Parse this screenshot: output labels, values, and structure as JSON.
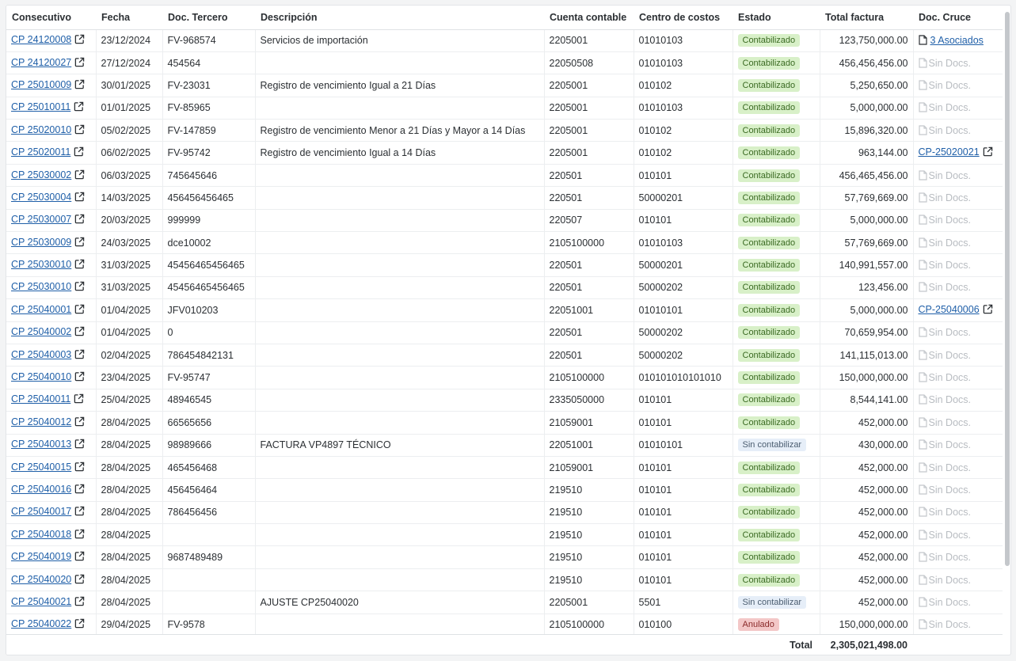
{
  "columns": [
    "Consecutivo",
    "Fecha",
    "Doc. Tercero",
    "Descripción",
    "Cuenta contable",
    "Centro de costos",
    "Estado",
    "Total factura",
    "Doc. Cruce"
  ],
  "rows": [
    {
      "id": "CP 24120008",
      "fecha": "23/12/2024",
      "doc": "FV-968574",
      "desc": "Servicios de importación",
      "cuenta": "2205001",
      "centro": "01010103",
      "estado": "Contabilizado",
      "estado_type": "ok",
      "total": "123,750,000.00",
      "cruce": "3 Asociados",
      "cruce_type": "assoc"
    },
    {
      "id": "CP 24120027",
      "fecha": "27/12/2024",
      "doc": "454564",
      "desc": "",
      "cuenta": "22050508",
      "centro": "01010103",
      "estado": "Contabilizado",
      "estado_type": "ok",
      "total": "456,456,456.00",
      "cruce": "Sin Docs.",
      "cruce_type": "none"
    },
    {
      "id": "CP 25010009",
      "fecha": "30/01/2025",
      "doc": "FV-23031",
      "desc": "Registro de vencimiento Igual a 21 Días",
      "cuenta": "2205001",
      "centro": "010102",
      "estado": "Contabilizado",
      "estado_type": "ok",
      "total": "5,250,650.00",
      "cruce": "Sin Docs.",
      "cruce_type": "none"
    },
    {
      "id": "CP 25010011",
      "fecha": "01/01/2025",
      "doc": "FV-85965",
      "desc": "",
      "cuenta": "2205001",
      "centro": "01010103",
      "estado": "Contabilizado",
      "estado_type": "ok",
      "total": "5,000,000.00",
      "cruce": "Sin Docs.",
      "cruce_type": "none"
    },
    {
      "id": "CP 25020010",
      "fecha": "05/02/2025",
      "doc": "FV-147859",
      "desc": "Registro de vencimiento Menor a 21 Días y Mayor a 14 Días",
      "cuenta": "2205001",
      "centro": "010102",
      "estado": "Contabilizado",
      "estado_type": "ok",
      "total": "15,896,320.00",
      "cruce": "Sin Docs.",
      "cruce_type": "none"
    },
    {
      "id": "CP 25020011",
      "fecha": "06/02/2025",
      "doc": "FV-95742",
      "desc": "Registro de vencimiento Igual a 14 Días",
      "cuenta": "2205001",
      "centro": "010102",
      "estado": "Contabilizado",
      "estado_type": "ok",
      "total": "963,144.00",
      "cruce": "CP-25020021",
      "cruce_type": "link"
    },
    {
      "id": "CP 25030002",
      "fecha": "06/03/2025",
      "doc": "745645646",
      "desc": "",
      "cuenta": "220501",
      "centro": "010101",
      "estado": "Contabilizado",
      "estado_type": "ok",
      "total": "456,465,456.00",
      "cruce": "Sin Docs.",
      "cruce_type": "none"
    },
    {
      "id": "CP 25030004",
      "fecha": "14/03/2025",
      "doc": "456456456465",
      "desc": "",
      "cuenta": "220501",
      "centro": "50000201",
      "estado": "Contabilizado",
      "estado_type": "ok",
      "total": "57,769,669.00",
      "cruce": "Sin Docs.",
      "cruce_type": "none"
    },
    {
      "id": "CP 25030007",
      "fecha": "20/03/2025",
      "doc": "999999",
      "desc": "",
      "cuenta": "220507",
      "centro": "010101",
      "estado": "Contabilizado",
      "estado_type": "ok",
      "total": "5,000,000.00",
      "cruce": "Sin Docs.",
      "cruce_type": "none"
    },
    {
      "id": "CP 25030009",
      "fecha": "24/03/2025",
      "doc": "dce10002",
      "desc": "",
      "cuenta": "2105100000",
      "centro": "01010103",
      "estado": "Contabilizado",
      "estado_type": "ok",
      "total": "57,769,669.00",
      "cruce": "Sin Docs.",
      "cruce_type": "none"
    },
    {
      "id": "CP 25030010",
      "fecha": "31/03/2025",
      "doc": "45456465456465",
      "desc": "",
      "cuenta": "220501",
      "centro": "50000201",
      "estado": "Contabilizado",
      "estado_type": "ok",
      "total": "140,991,557.00",
      "cruce": "Sin Docs.",
      "cruce_type": "none"
    },
    {
      "id": "CP 25030010",
      "fecha": "31/03/2025",
      "doc": "45456465456465",
      "desc": "",
      "cuenta": "220501",
      "centro": "50000202",
      "estado": "Contabilizado",
      "estado_type": "ok",
      "total": "123,456.00",
      "cruce": "Sin Docs.",
      "cruce_type": "none"
    },
    {
      "id": "CP 25040001",
      "fecha": "01/04/2025",
      "doc": "JFV010203",
      "desc": "",
      "cuenta": "22051001",
      "centro": "01010101",
      "estado": "Contabilizado",
      "estado_type": "ok",
      "total": "5,000,000.00",
      "cruce": "CP-25040006",
      "cruce_type": "link"
    },
    {
      "id": "CP 25040002",
      "fecha": "01/04/2025",
      "doc": "0",
      "desc": "",
      "cuenta": "220501",
      "centro": "50000202",
      "estado": "Contabilizado",
      "estado_type": "ok",
      "total": "70,659,954.00",
      "cruce": "Sin Docs.",
      "cruce_type": "none"
    },
    {
      "id": "CP 25040003",
      "fecha": "02/04/2025",
      "doc": "786454842131",
      "desc": "",
      "cuenta": "220501",
      "centro": "50000202",
      "estado": "Contabilizado",
      "estado_type": "ok",
      "total": "141,115,013.00",
      "cruce": "Sin Docs.",
      "cruce_type": "none"
    },
    {
      "id": "CP 25040010",
      "fecha": "23/04/2025",
      "doc": "FV-95747",
      "desc": "",
      "cuenta": "2105100000",
      "centro": "010101010101010",
      "estado": "Contabilizado",
      "estado_type": "ok",
      "total": "150,000,000.00",
      "cruce": "Sin Docs.",
      "cruce_type": "none"
    },
    {
      "id": "CP 25040011",
      "fecha": "25/04/2025",
      "doc": "48946545",
      "desc": "",
      "cuenta": "2335050000",
      "centro": "010101",
      "estado": "Contabilizado",
      "estado_type": "ok",
      "total": "8,544,141.00",
      "cruce": "Sin Docs.",
      "cruce_type": "none"
    },
    {
      "id": "CP 25040012",
      "fecha": "28/04/2025",
      "doc": "66565656",
      "desc": "",
      "cuenta": "21059001",
      "centro": "010101",
      "estado": "Contabilizado",
      "estado_type": "ok",
      "total": "452,000.00",
      "cruce": "Sin Docs.",
      "cruce_type": "none"
    },
    {
      "id": "CP 25040013",
      "fecha": "28/04/2025",
      "doc": "98989666",
      "desc": "FACTURA VP4897 TÉCNICO",
      "cuenta": "22051001",
      "centro": "01010101",
      "estado": "Sin contabilizar",
      "estado_type": "pend",
      "total": "430,000.00",
      "cruce": "Sin Docs.",
      "cruce_type": "none"
    },
    {
      "id": "CP 25040015",
      "fecha": "28/04/2025",
      "doc": "465456468",
      "desc": "",
      "cuenta": "21059001",
      "centro": "010101",
      "estado": "Contabilizado",
      "estado_type": "ok",
      "total": "452,000.00",
      "cruce": "Sin Docs.",
      "cruce_type": "none"
    },
    {
      "id": "CP 25040016",
      "fecha": "28/04/2025",
      "doc": "456456464",
      "desc": "",
      "cuenta": "219510",
      "centro": "010101",
      "estado": "Contabilizado",
      "estado_type": "ok",
      "total": "452,000.00",
      "cruce": "Sin Docs.",
      "cruce_type": "none"
    },
    {
      "id": "CP 25040017",
      "fecha": "28/04/2025",
      "doc": "786456456",
      "desc": "",
      "cuenta": "219510",
      "centro": "010101",
      "estado": "Contabilizado",
      "estado_type": "ok",
      "total": "452,000.00",
      "cruce": "Sin Docs.",
      "cruce_type": "none"
    },
    {
      "id": "CP 25040018",
      "fecha": "28/04/2025",
      "doc": "",
      "desc": "",
      "cuenta": "219510",
      "centro": "010101",
      "estado": "Contabilizado",
      "estado_type": "ok",
      "total": "452,000.00",
      "cruce": "Sin Docs.",
      "cruce_type": "none"
    },
    {
      "id": "CP 25040019",
      "fecha": "28/04/2025",
      "doc": "9687489489",
      "desc": "",
      "cuenta": "219510",
      "centro": "010101",
      "estado": "Contabilizado",
      "estado_type": "ok",
      "total": "452,000.00",
      "cruce": "Sin Docs.",
      "cruce_type": "none"
    },
    {
      "id": "CP 25040020",
      "fecha": "28/04/2025",
      "doc": "",
      "desc": "",
      "cuenta": "219510",
      "centro": "010101",
      "estado": "Contabilizado",
      "estado_type": "ok",
      "total": "452,000.00",
      "cruce": "Sin Docs.",
      "cruce_type": "none"
    },
    {
      "id": "CP 25040021",
      "fecha": "28/04/2025",
      "doc": "",
      "desc": "AJUSTE CP25040020",
      "cuenta": "2205001",
      "centro": "5501",
      "estado": "Sin contabilizar",
      "estado_type": "pend",
      "total": "452,000.00",
      "cruce": "Sin Docs.",
      "cruce_type": "none"
    },
    {
      "id": "CP 25040022",
      "fecha": "29/04/2025",
      "doc": "FV-9578",
      "desc": "",
      "cuenta": "2105100000",
      "centro": "010100",
      "estado": "Anulado",
      "estado_type": "null",
      "total": "150,000,000.00",
      "cruce": "Sin Docs.",
      "cruce_type": "none"
    }
  ],
  "footer": {
    "label": "Total",
    "value": "2,305,021,498.00"
  },
  "icons": {
    "external": "external-link-icon",
    "document": "document-icon"
  },
  "colors": {
    "link": "#1f5fa8",
    "ok_bg": "#d8f0c8",
    "pend_bg": "#e6eef8",
    "null_bg": "#f3c7c7"
  }
}
